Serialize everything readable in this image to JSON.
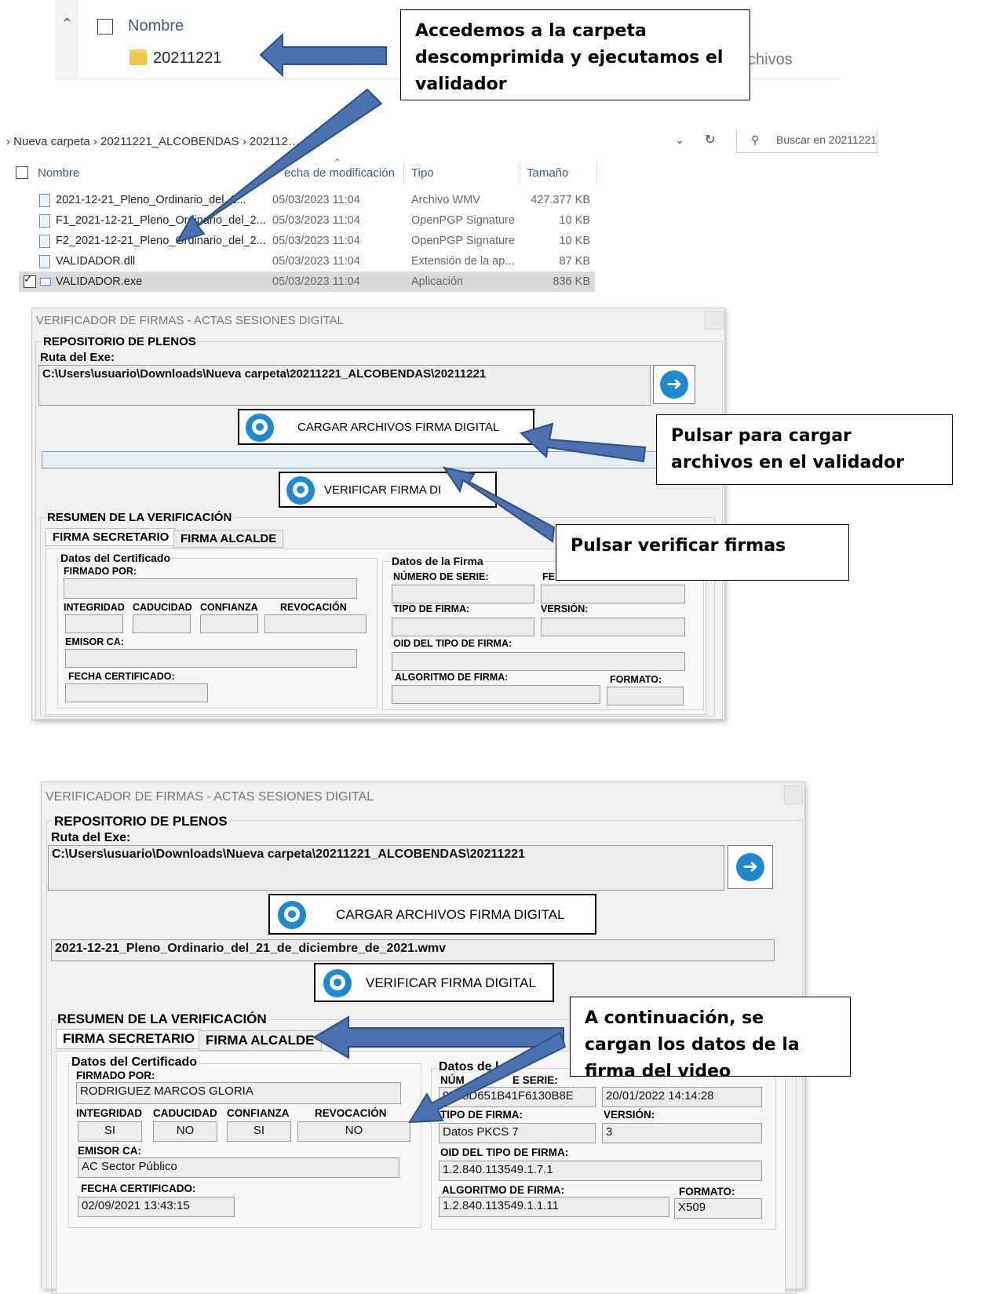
{
  "explorer_top": {
    "column_header": "Nombre",
    "folder_name": "20211221",
    "partial_text": "chivos"
  },
  "callouts": {
    "c1": "Accedemos a la carpeta descomprimida y ejecutamos el validador",
    "c2": "Pulsar para cargar archivos en el validador",
    "c3": "Pulsar verificar firmas",
    "c4": "A continuación, se cargan los datos de la firma del video"
  },
  "explorer_list": {
    "breadcrumb": "›  Nueva carpeta  ›  20211221_ALCOBENDAS  ›  202112…",
    "search_placeholder": "Buscar en 20211221",
    "headers": {
      "name": "Nombre",
      "modified": "echa de modificación",
      "type": "Tipo",
      "size": "Tamaño"
    },
    "rows": [
      {
        "name": "2021-12-21_Pleno_Ordinario_del_2...",
        "modified": "05/03/2023 11:04",
        "type": "Archivo WMV",
        "size": "427.377 KB"
      },
      {
        "name": "F1_2021-12-21_Pleno_Ordinario_del_2...",
        "modified": "05/03/2023 11:04",
        "type": "OpenPGP Signature",
        "size": "10 KB"
      },
      {
        "name": "F2_2021-12-21_Pleno_Ordinario_del_2...",
        "modified": "05/03/2023 11:04",
        "type": "OpenPGP Signature",
        "size": "10 KB"
      },
      {
        "name": "VALIDADOR.dll",
        "modified": "05/03/2023 11:04",
        "type": "Extensión de la ap...",
        "size": "87 KB"
      },
      {
        "name": "VALIDADOR.exe",
        "modified": "05/03/2023 11:04",
        "type": "Aplicación",
        "size": "836 KB"
      }
    ]
  },
  "validator": {
    "title": "VERIFICADOR DE FIRMAS - ACTAS SESIONES DIGITAL",
    "group_repo": "REPOSITORIO DE PLENOS",
    "path_label": "Ruta del Exe:",
    "path_value": "C:\\Users\\usuario\\Downloads\\Nueva carpeta\\20211221_ALCOBENDAS\\20211221",
    "load_button": "CARGAR ARCHIVOS FIRMA DIGITAL",
    "verify_button": "VERIFICAR FIRMA DIGITAL",
    "verify_button_partial": "VERIFICAR FIRMA DI",
    "summary": "RESUMEN DE LA VERIFICACIÓN",
    "tab_secretary": "FIRMA SECRETARIO",
    "tab_mayor": "FIRMA ALCALDE",
    "cert_group": "Datos del Certificado",
    "firm_group": "Datos de la Firma",
    "firm_group_partial": "Datos de l",
    "signed_by": "FIRMADO POR:",
    "integrity": "INTEGRIDAD",
    "expiry": "CADUCIDAD",
    "trust": "CONFIANZA",
    "revocation": "REVOCACIÓN",
    "issuer": "EMISOR CA:",
    "cert_date": "FECHA CERTIFICADO:",
    "serial": "NÚMERO DE SERIE:",
    "serial_partial": "NÚM",
    "serial_partial2": "E SERIE:",
    "local_date": "FECHA FIRMA LOCAL:",
    "local_date_partial": "FE",
    "sig_type": "TIPO  DE FIRMA:",
    "version": "VERSIÓN:",
    "oid": "OID DEL TIPO DE FIRMA:",
    "algorithm": "ALGORITMO DE FIRMA:",
    "format": "FORMATO:"
  },
  "validator_filled": {
    "file_loaded": "2021-12-21_Pleno_Ordinario_del_21_de_diciembre_de_2021.wmv",
    "signed_by_value": "RODRIGUEZ MARCOS GLORIA",
    "integrity_value": "SI",
    "expiry_value": "NO",
    "trust_value": "SI",
    "revocation_value": "NO",
    "issuer_value": "AC Sector Público",
    "cert_date_value": "02/09/2021 13:43:15",
    "serial_value": "9555D651B41F6130B8E",
    "local_date_value": "20/01/2022 14:14:28",
    "sig_type_value": "Datos PKCS 7",
    "version_value": "3",
    "oid_value": "1.2.840.113549.1.7.1",
    "algorithm_value": "1.2.840.113549.1.1.11",
    "format_value": "X509"
  },
  "colors": {
    "arrow": "#4a72b0",
    "arrow_border": "#2f4f80",
    "badge": "#1e88d0"
  }
}
